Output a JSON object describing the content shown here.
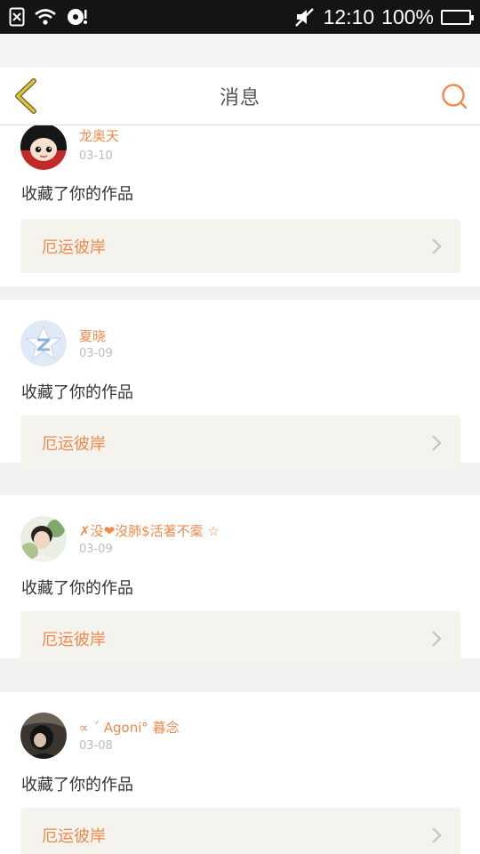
{
  "status_bar": {
    "time": "12:10",
    "battery": "100%"
  },
  "nav": {
    "title": "消息"
  },
  "colors": {
    "accent": "#f08a4b",
    "back_icon": "#e8c23a",
    "card_bg": "#ffffff",
    "work_bg": "#f4f3ee"
  },
  "messages": [
    {
      "username": "龙奥天",
      "date": "03-10",
      "action": "收藏了你的作品",
      "work_title": "厄运彼岸"
    },
    {
      "username": "夏晓",
      "date": "03-09",
      "action": "收藏了你的作品",
      "work_title": "厄运彼岸"
    },
    {
      "username": "✗没❤沒肺$活著不槖 ☆",
      "date": "03-09",
      "action": "收藏了你的作品",
      "work_title": "厄运彼岸"
    },
    {
      "username": "∝ ˊ Agoni° 暮念",
      "date": "03-08",
      "action": "收藏了你的作品",
      "work_title": "厄运彼岸"
    }
  ]
}
